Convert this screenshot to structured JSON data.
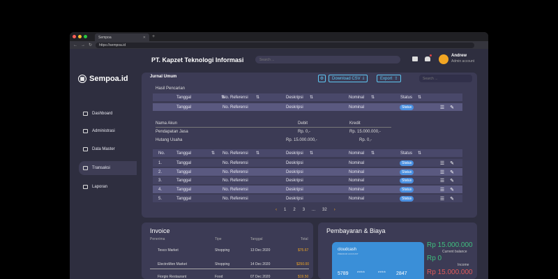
{
  "browser": {
    "tab_title": "Sempoa",
    "url": "https://sempoa.id"
  },
  "app": {
    "brand": "Sempoa.id",
    "company": "PT. Kapzet Teknologi Informasi",
    "search_placeholder": "Search ...",
    "user": {
      "name": "Andrew",
      "role": "Admin account"
    },
    "nav": [
      {
        "label": "Dashboard",
        "icon": "dashboard-icon"
      },
      {
        "label": "Administrasi",
        "icon": "users-icon"
      },
      {
        "label": "Data Master",
        "icon": "database-icon"
      },
      {
        "label": "Transaksi",
        "icon": "transaction-icon",
        "active": true
      },
      {
        "label": "Laporan",
        "icon": "report-icon"
      }
    ]
  },
  "jurnal": {
    "title": "Jurnal Umum",
    "download_label": "Download CSV",
    "export_label": "Export",
    "search_placeholder": "Search ...",
    "hasil_label": "Hasil Pencarian",
    "headers": {
      "tanggal": "Tanggal",
      "ref": "No. Referensi",
      "desk": "Deskripsi",
      "nominal": "Nominal",
      "status": "Status",
      "no": "No."
    },
    "search_row": {
      "tanggal": "Tanggal",
      "ref": "No. Referensi",
      "desk": "Deskripsi",
      "nominal": "Nominal",
      "status": "Status"
    },
    "akun": {
      "col_akun": "Nama Akun",
      "col_debit": "Debit",
      "col_kredit": "Kredit",
      "rows": [
        {
          "nama": "Pendapatan Jasa",
          "debit": "Rp. 0,-",
          "kredit": "Rp. 15.000.000,-"
        },
        {
          "nama": "Hutang Usaha",
          "debit": "Rp. 15.000.000,-",
          "kredit": "Rp. 0,-"
        }
      ]
    },
    "rows": [
      {
        "no": "1.",
        "tanggal": "Tanggal",
        "ref": "No. Referensi",
        "desk": "Deskripsi",
        "nominal": "Nominal",
        "status": "Status"
      },
      {
        "no": "2.",
        "tanggal": "Tanggal",
        "ref": "No. Referensi",
        "desk": "Deskripsi",
        "nominal": "Nominal",
        "status": "Status"
      },
      {
        "no": "3.",
        "tanggal": "Tanggal",
        "ref": "No. Referensi",
        "desk": "Deskripsi",
        "nominal": "Nominal",
        "status": "Status"
      },
      {
        "no": "4.",
        "tanggal": "Tanggal",
        "ref": "No. Referensi",
        "desk": "Deskripsi",
        "nominal": "Nominal",
        "status": "Status"
      },
      {
        "no": "5.",
        "tanggal": "Tanggal",
        "ref": "No. Referensi",
        "desk": "Deskripsi",
        "nominal": "Nominal",
        "status": "Status"
      }
    ],
    "pager": {
      "prev": "‹",
      "p1": "1",
      "p2": "2",
      "p3": "3",
      "dots": "...",
      "last": "32",
      "next": "›"
    }
  },
  "invoice": {
    "title": "Invoice",
    "headers": {
      "penerima": "Penerima",
      "tipe": "Tipe",
      "tanggal": "Tanggal",
      "total": "Total"
    },
    "rows": [
      {
        "penerima": "Tesco Market",
        "tipe": "Shopping",
        "tanggal": "13 Dec 2020",
        "total": "$75.67"
      },
      {
        "penerima": "ElectroMen Market",
        "tipe": "Shopping",
        "tanggal": "14 Dec 2020",
        "total": "$250.00"
      },
      {
        "penerima": "Fiorgio Restaurant",
        "tipe": "Food",
        "tanggal": "07 Dec 2020",
        "total": "$19.50"
      }
    ]
  },
  "payment": {
    "title": "Pembayaran & Biaya",
    "card": {
      "name": "cloudcash",
      "sub": "PREMIUM ACCOUNT",
      "n1": "5789",
      "stars1": "****",
      "stars2": "****",
      "n4": "2847"
    },
    "balance": "Rp 15.000.000",
    "balance_label": "Current balance",
    "income": "Rp 0",
    "income_label": "Income",
    "outcome": "Rp 15.000.000"
  },
  "colors": {
    "accent": "#5ec7f2",
    "status": "#4a8fe0",
    "orange": "#f2a623",
    "income": "#3fbf7f",
    "outcome": "#e05a5a"
  }
}
